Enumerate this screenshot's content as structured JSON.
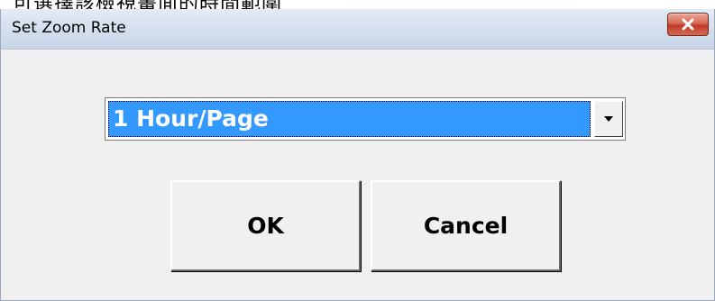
{
  "top_strip_text": "可選擇該檢視畫面的時間範圍",
  "dialog": {
    "title": "Set Zoom Rate",
    "close_icon": "close-icon"
  },
  "zoom_select": {
    "selected": "1 Hour/Page",
    "arrow_icon": "chevron-down-icon"
  },
  "buttons": {
    "ok_label": "OK",
    "cancel_label": "Cancel"
  },
  "colors": {
    "selection": "#3399ff",
    "close_button": "#c0392b",
    "dialog_bg": "#f0f0f0"
  }
}
